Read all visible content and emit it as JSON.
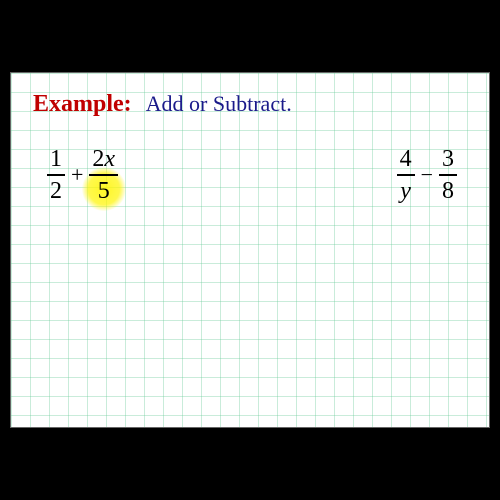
{
  "header": {
    "example_label": "Example:",
    "instruction": "Add or Subtract."
  },
  "problems": {
    "left": {
      "frac1": {
        "num": "1",
        "den": "2"
      },
      "op": "+",
      "frac2": {
        "num": "2x",
        "den": "5"
      }
    },
    "right": {
      "frac1": {
        "num": "4",
        "den": "y"
      },
      "op": "−",
      "frac2": {
        "num": "3",
        "den": "8"
      }
    }
  }
}
